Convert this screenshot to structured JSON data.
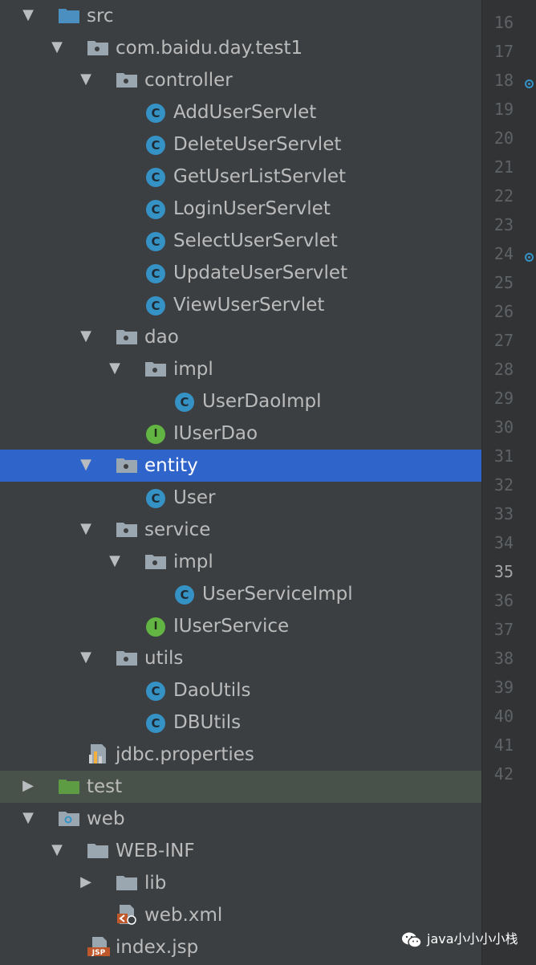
{
  "tree": [
    {
      "label": "src",
      "depth": 0,
      "kind": "src-folder",
      "expanded": true
    },
    {
      "label": "com.baidu.day.test1",
      "depth": 1,
      "kind": "package",
      "expanded": true
    },
    {
      "label": "controller",
      "depth": 2,
      "kind": "package",
      "expanded": true
    },
    {
      "label": "AddUserServlet",
      "depth": 3,
      "kind": "class"
    },
    {
      "label": "DeleteUserServlet",
      "depth": 3,
      "kind": "class"
    },
    {
      "label": "GetUserListServlet",
      "depth": 3,
      "kind": "class"
    },
    {
      "label": "LoginUserServlet",
      "depth": 3,
      "kind": "class"
    },
    {
      "label": "SelectUserServlet",
      "depth": 3,
      "kind": "class"
    },
    {
      "label": "UpdateUserServlet",
      "depth": 3,
      "kind": "class"
    },
    {
      "label": "ViewUserServlet",
      "depth": 3,
      "kind": "class"
    },
    {
      "label": "dao",
      "depth": 2,
      "kind": "package",
      "expanded": true
    },
    {
      "label": "impl",
      "depth": 3,
      "kind": "package",
      "expanded": true
    },
    {
      "label": "UserDaoImpl",
      "depth": 4,
      "kind": "class"
    },
    {
      "label": "IUserDao",
      "depth": 3,
      "kind": "interface"
    },
    {
      "label": "entity",
      "depth": 2,
      "kind": "package",
      "expanded": true,
      "selected": true
    },
    {
      "label": "User",
      "depth": 3,
      "kind": "class"
    },
    {
      "label": "service",
      "depth": 2,
      "kind": "package",
      "expanded": true
    },
    {
      "label": "impl",
      "depth": 3,
      "kind": "package",
      "expanded": true
    },
    {
      "label": "UserServiceImpl",
      "depth": 4,
      "kind": "class"
    },
    {
      "label": "IUserService",
      "depth": 3,
      "kind": "interface"
    },
    {
      "label": "utils",
      "depth": 2,
      "kind": "package",
      "expanded": true
    },
    {
      "label": "DaoUtils",
      "depth": 3,
      "kind": "class"
    },
    {
      "label": "DBUtils",
      "depth": 3,
      "kind": "class"
    },
    {
      "label": "jdbc.properties",
      "depth": 1,
      "kind": "properties"
    },
    {
      "label": "test",
      "depth": 0,
      "kind": "test-folder",
      "expanded": false,
      "highlight": true
    },
    {
      "label": "web",
      "depth": 0,
      "kind": "web-folder",
      "expanded": true
    },
    {
      "label": "WEB-INF",
      "depth": 1,
      "kind": "folder",
      "expanded": true
    },
    {
      "label": "lib",
      "depth": 2,
      "kind": "folder",
      "expanded": false
    },
    {
      "label": "web.xml",
      "depth": 2,
      "kind": "xml"
    },
    {
      "label": "index.jsp",
      "depth": 1,
      "kind": "jsp"
    }
  ],
  "icons": {
    "class": "C",
    "interface": "I",
    "jsp": "JSP"
  },
  "gutter": {
    "lines": [
      "16",
      "17",
      "18",
      "19",
      "20",
      "21",
      "22",
      "23",
      "24",
      "25",
      "26",
      "27",
      "28",
      "29",
      "30",
      "31",
      "32",
      "33",
      "34",
      "35",
      "36",
      "37",
      "38",
      "39",
      "40",
      "41",
      "42"
    ],
    "current_line": "35",
    "breakpoint_lines": [
      "18",
      "24"
    ]
  },
  "watermark": {
    "text": "java小小小小栈"
  },
  "colors": {
    "selection": "#2f65ca",
    "class_icon": "#3592c4",
    "interface_icon": "#62b543",
    "test_highlight": "#49524a"
  }
}
